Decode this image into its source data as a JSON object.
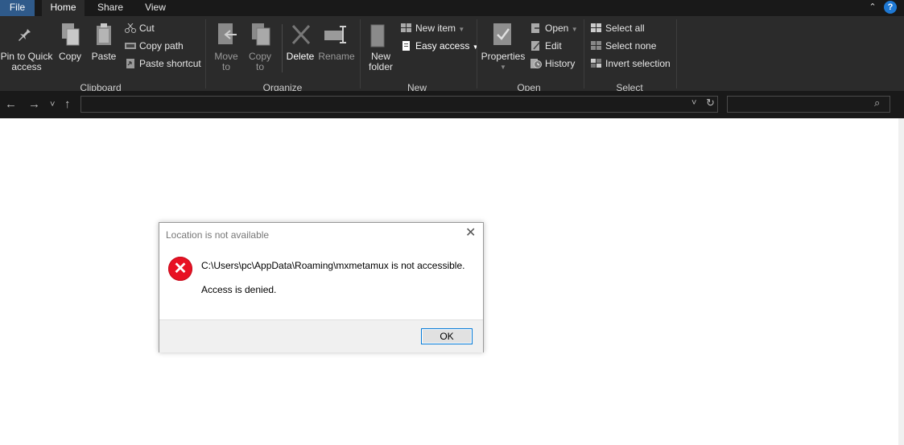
{
  "tabs": {
    "file": "File",
    "home": "Home",
    "share": "Share",
    "view": "View"
  },
  "help_glyph": "?",
  "caret_glyph": "⌃",
  "ribbon": {
    "clipboard": {
      "group": "Clipboard",
      "pin_line1": "Pin to Quick",
      "pin_line2": "access",
      "copy": "Copy",
      "paste": "Paste",
      "cut": "Cut",
      "copy_path": "Copy path",
      "paste_shortcut": "Paste shortcut"
    },
    "organize": {
      "group": "Organize",
      "move_line1": "Move",
      "move_line2": "to",
      "copy_line1": "Copy",
      "copy_line2": "to",
      "delete": "Delete",
      "rename": "Rename"
    },
    "new": {
      "group": "New",
      "folder_line1": "New",
      "folder_line2": "folder",
      "new_item": "New item",
      "easy_access": "Easy access"
    },
    "open": {
      "group": "Open",
      "properties": "Properties",
      "open": "Open",
      "edit": "Edit",
      "history": "History"
    },
    "select": {
      "group": "Select",
      "select_all": "Select all",
      "select_none": "Select none",
      "invert": "Invert selection"
    }
  },
  "nav": {
    "back": "←",
    "forward": "→",
    "recent": "˅",
    "up": "↑",
    "address_dropdown": "˅",
    "refresh": "↻",
    "search_icon": "⌕"
  },
  "dialog": {
    "title": "Location is not available",
    "close": "✕",
    "error_glyph": "✕",
    "message": "C:\\Users\\pc\\AppData\\Roaming\\mxmetamux is not accessible.",
    "detail": "Access is denied.",
    "ok": "OK"
  },
  "colors": {
    "ribbon_bg": "#2b2b2b",
    "tab_bar_bg": "#191919",
    "file_tab": "#2f5a8a",
    "error_red": "#e81123",
    "ok_border": "#0078d7"
  }
}
